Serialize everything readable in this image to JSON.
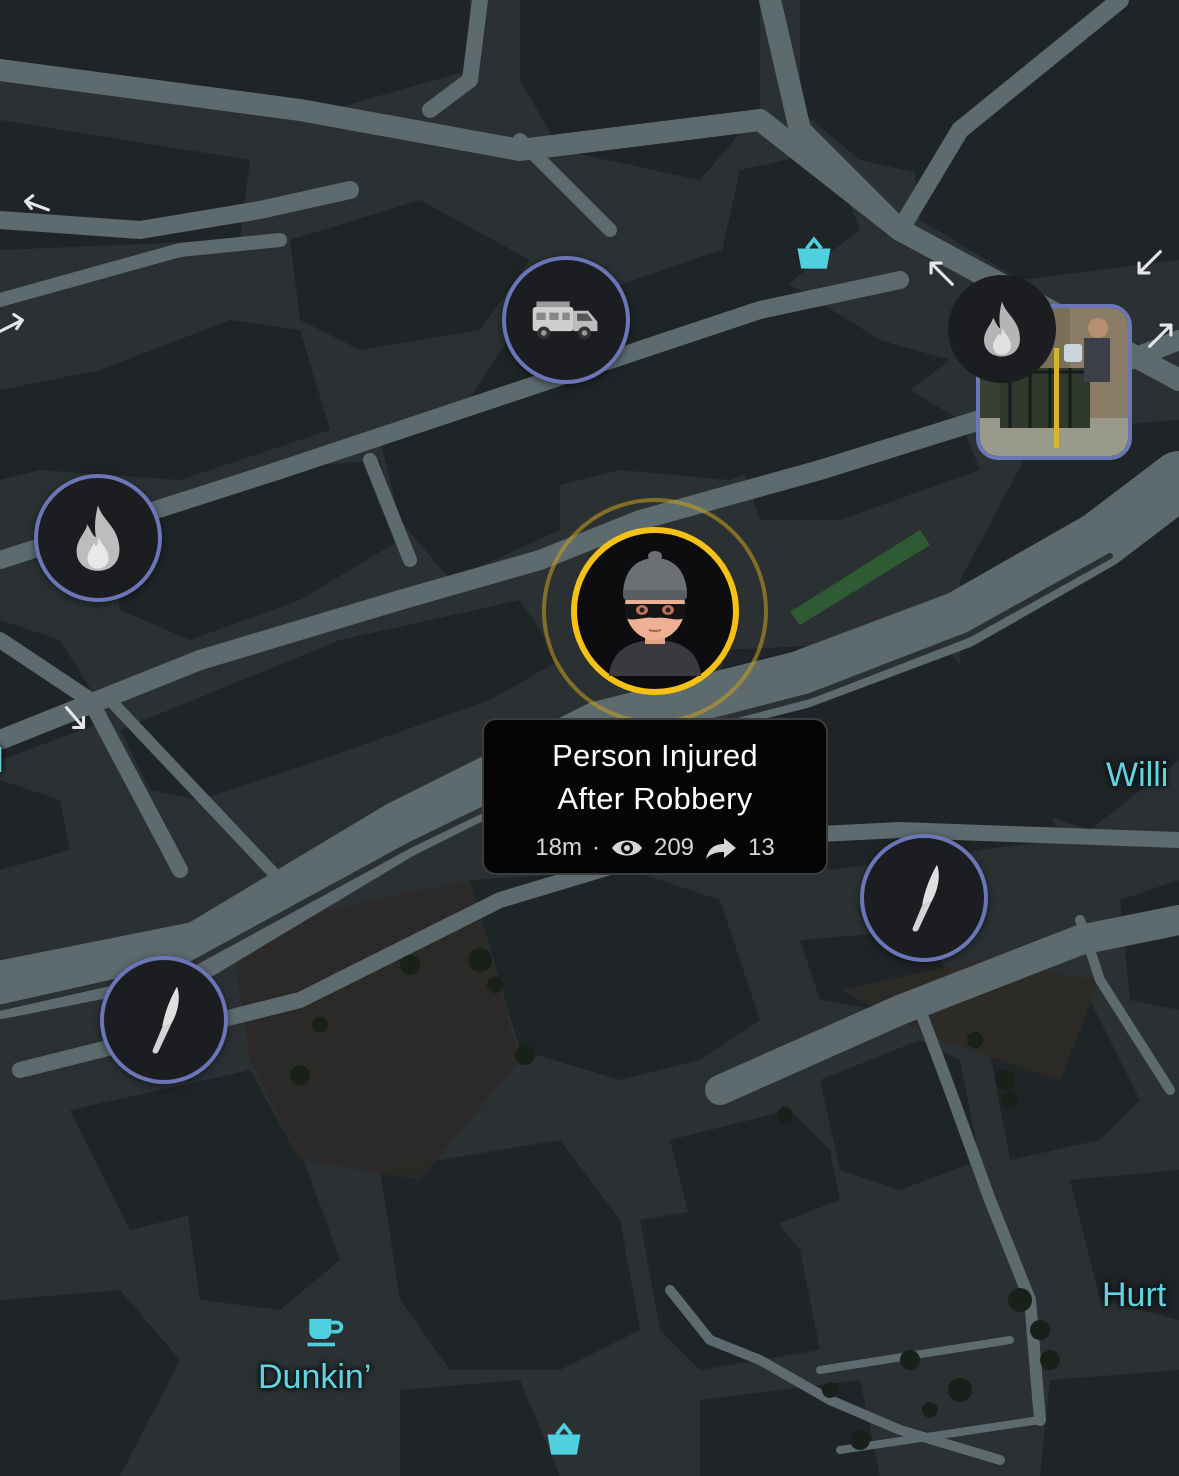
{
  "map": {
    "place_labels": {
      "dunkin": "Dunkin’",
      "street_right_1": "Willi",
      "street_right_2": "Hurt",
      "street_left": "l"
    }
  },
  "featured_incident": {
    "icon": "burglar-avatar-icon",
    "title_line1": "Person Injured",
    "title_line2": "After Robbery",
    "age": "18m",
    "separator": "·",
    "views": "209",
    "shares": "13",
    "ring_color": "#f5c116"
  },
  "incident_markers": [
    {
      "name": "fire-truck-marker",
      "icon": "fire-truck-icon"
    },
    {
      "name": "fire-marker",
      "icon": "flame-icon"
    },
    {
      "name": "knife-marker",
      "icon": "knife-icon"
    },
    {
      "name": "knife-marker",
      "icon": "knife-icon"
    },
    {
      "name": "photo-fire-marker",
      "icon": "flame-icon"
    }
  ],
  "poi_icons": [
    "shopping-basket-icon",
    "coffee-cup-icon",
    "shopping-basket-icon"
  ],
  "colors": {
    "map_background": "#2b3133",
    "road": "#5d6b6e",
    "building": "#1f2426",
    "marker_border": "#6b76b8",
    "poi_accent": "#63d3df"
  }
}
